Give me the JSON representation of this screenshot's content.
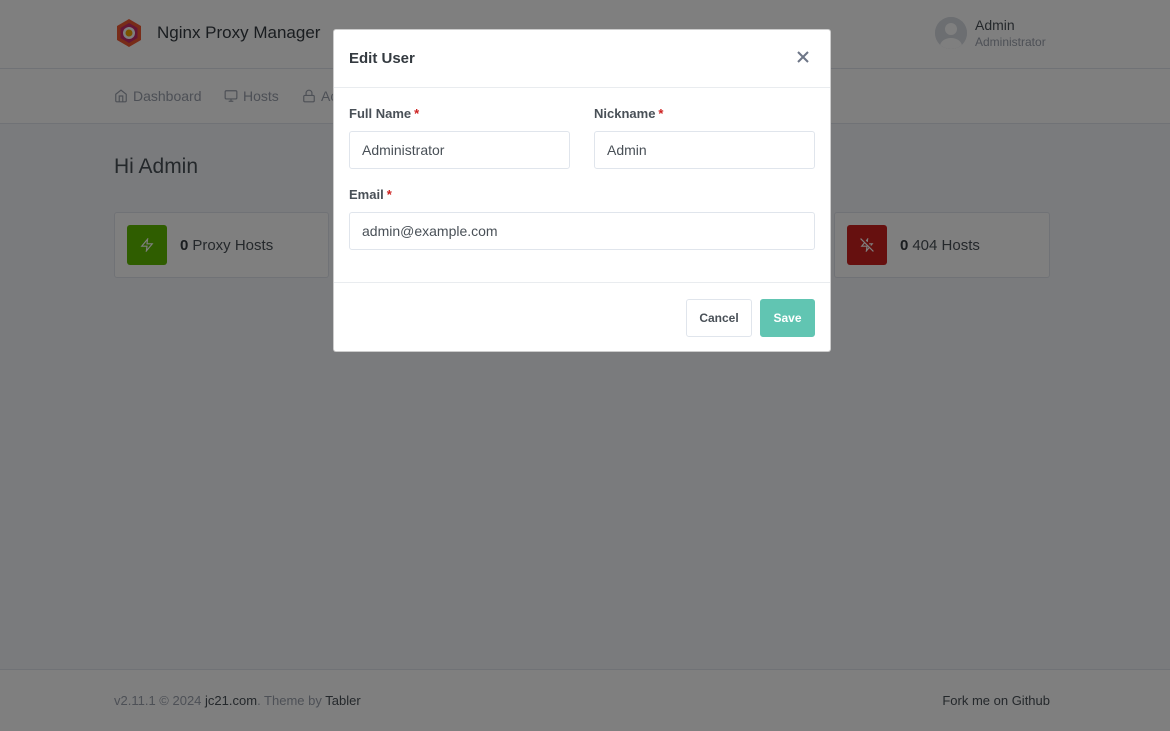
{
  "header": {
    "brand_name": "Nginx Proxy Manager",
    "user_name": "Admin",
    "user_role": "Administrator"
  },
  "nav": {
    "items": [
      {
        "label": "Dashboard",
        "icon": "home-icon"
      },
      {
        "label": "Hosts",
        "icon": "monitor-icon"
      },
      {
        "label": "Ac",
        "icon": "lock-icon"
      }
    ]
  },
  "main": {
    "greeting": "Hi Admin",
    "stats": [
      {
        "count": "0",
        "label": "Proxy Hosts",
        "icon": "zap-icon",
        "color": "#5eba00"
      },
      {
        "count": "0",
        "label": "404 Hosts",
        "icon": "zap-off-icon",
        "color": "#cd201f"
      }
    ]
  },
  "footer": {
    "version": "v2.11.1 © 2024",
    "author_link": "jc21.com",
    "theme_by": ". Theme by",
    "theme_link": "Tabler",
    "github": "Fork me on Github"
  },
  "modal": {
    "title": "Edit User",
    "full_name_label": "Full Name",
    "full_name_value": "Administrator",
    "nickname_label": "Nickname",
    "nickname_value": "Admin",
    "email_label": "Email",
    "email_value": "admin@example.com",
    "required_mark": "*",
    "cancel_label": "Cancel",
    "save_label": "Save"
  },
  "colors": {
    "accent": "#61c5b2",
    "required": "#cd201f"
  }
}
